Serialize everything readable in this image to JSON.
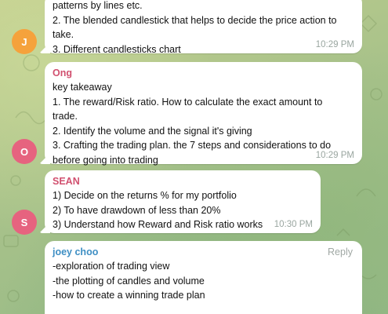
{
  "colors": {
    "chat_background": "#a9c38b",
    "bubble": "#ffffff",
    "timestamp": "#9aa6a0",
    "text": "#111111"
  },
  "messages": [
    {
      "avatar_letter": "J",
      "avatar_color": "#f5a23c",
      "sender": "",
      "lines": [
        "patterns by lines etc.",
        "2. The blended candlestick that helps to decide the price action to",
        "take.",
        "3. Different candlesticks chart"
      ],
      "time": "10:29 PM"
    },
    {
      "avatar_letter": "O",
      "avatar_color": "#e6637f",
      "sender": "Ong",
      "sender_color": "#d1506f",
      "lines": [
        "key takeaway",
        "1. The reward/Risk ratio. How to calculate the exact amount to",
        "trade.",
        "2. Identify the volume and the signal it's giving",
        "3. Crafting the trading plan. the 7 steps and considerations to do",
        "before going into trading"
      ],
      "time": "10:29 PM"
    },
    {
      "avatar_letter": "S",
      "avatar_color": "#e6637f",
      "sender": "SEAN",
      "sender_color": "#d1506f",
      "lines": [
        "1) Decide on the returns % for my portfolio",
        "2) To have drawdown of less than 20%",
        "3) Understand how Reward and Risk ratio works"
      ],
      "time": "10:30 PM"
    },
    {
      "avatar_letter": "",
      "avatar_color": "",
      "sender": "joey choo",
      "sender_color": "#3f8fc4",
      "reply_label": "Reply",
      "lines": [
        "-exploration of trading view",
        "-the plotting of candles and volume",
        "-how to create a winning trade plan"
      ],
      "time": ""
    }
  ]
}
